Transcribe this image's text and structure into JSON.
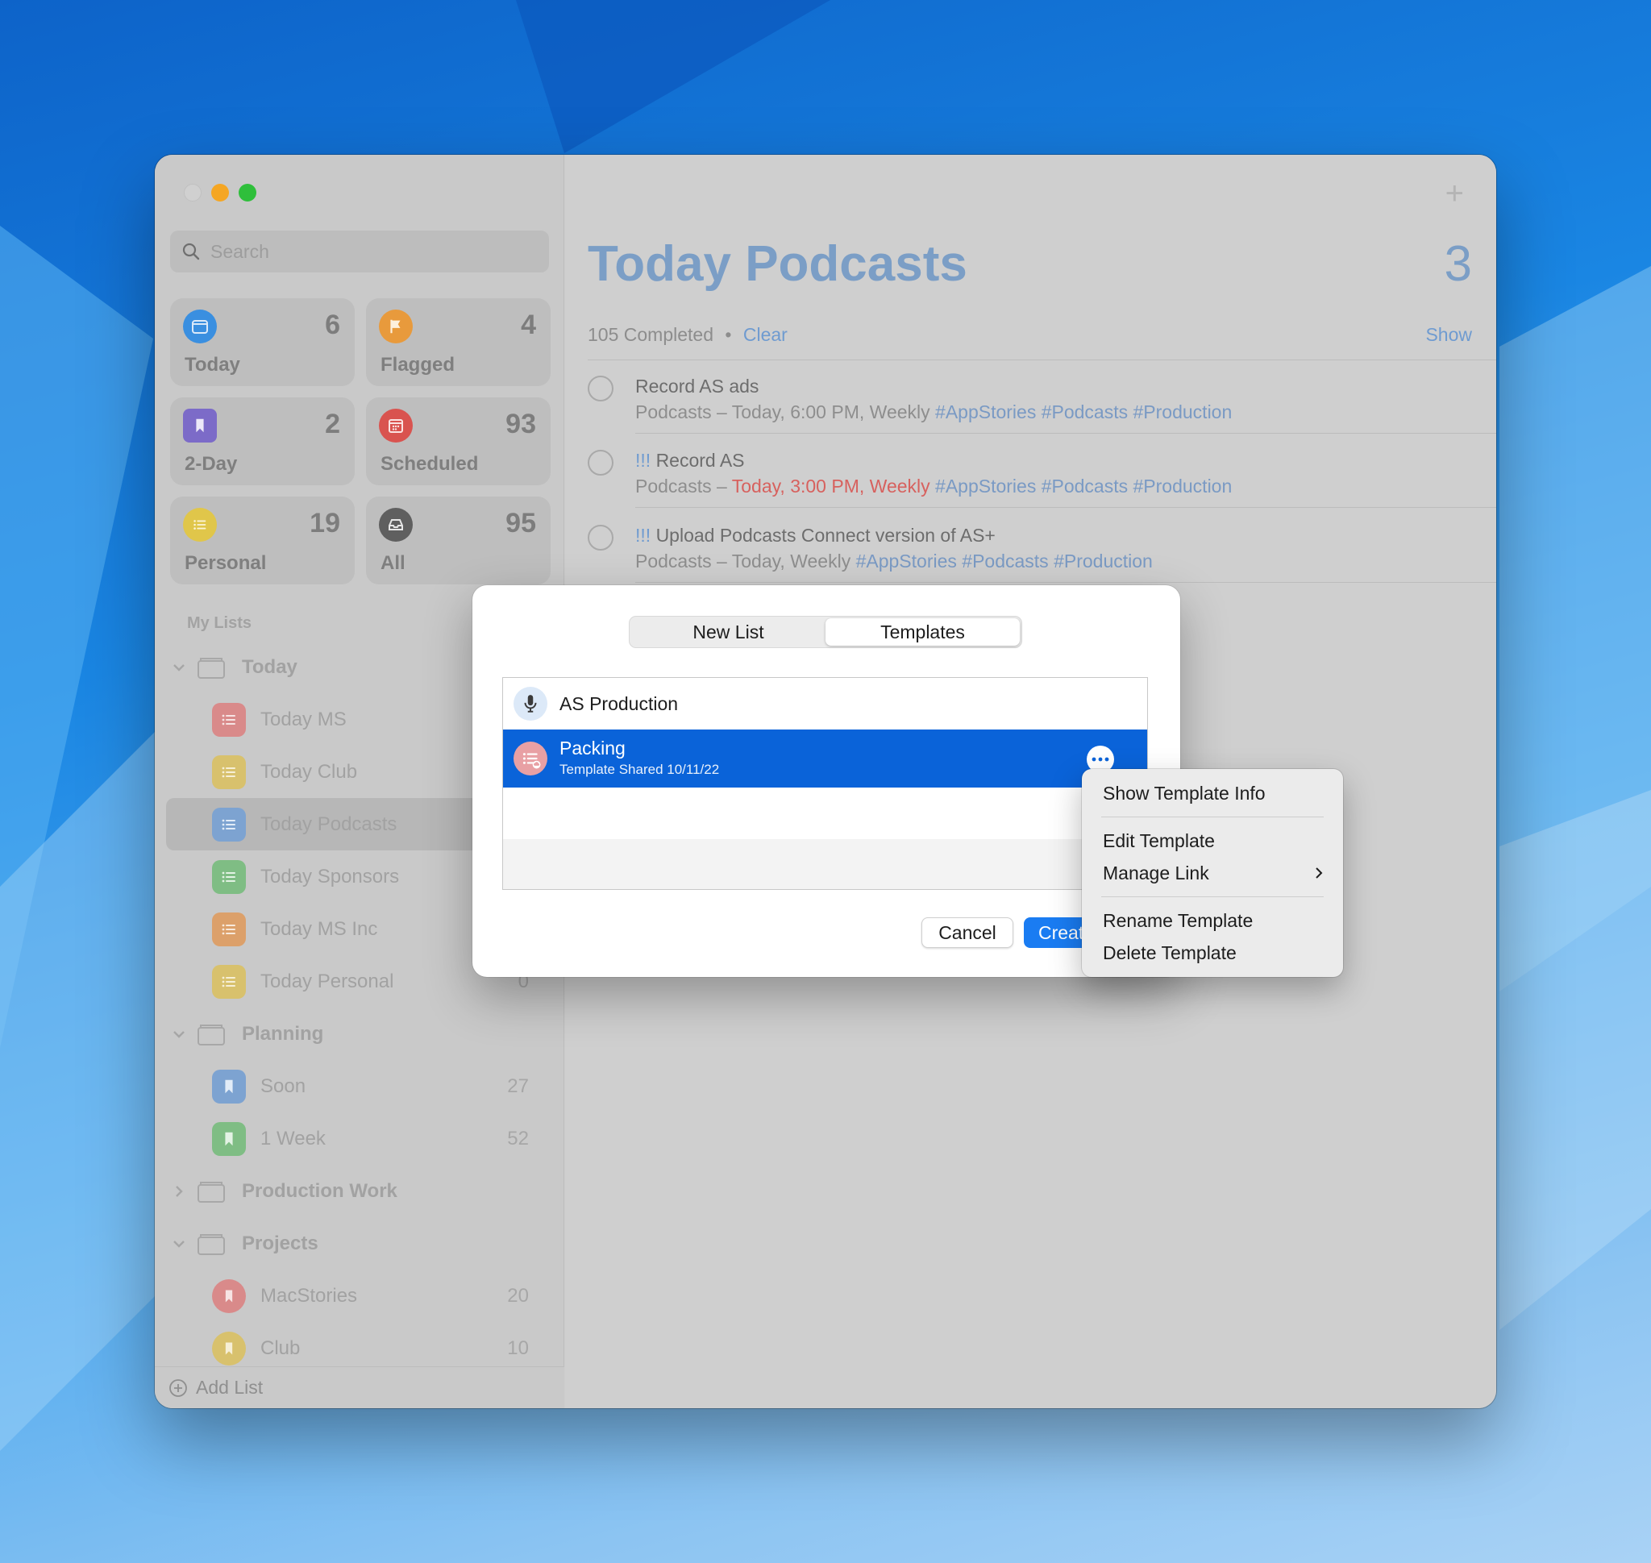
{
  "search": {
    "placeholder": "Search"
  },
  "smart_lists": [
    {
      "label": "Today",
      "count": "6",
      "icon": "calendar-icon",
      "color": "#3a8fe0"
    },
    {
      "label": "Flagged",
      "count": "4",
      "icon": "flag-icon",
      "color": "#e89a3c"
    },
    {
      "label": "2-Day",
      "count": "2",
      "icon": "bookmark-icon",
      "color": "#7c6bc8"
    },
    {
      "label": "Scheduled",
      "count": "93",
      "icon": "calendar-grid-icon",
      "color": "#d9534f"
    },
    {
      "label": "Personal",
      "count": "19",
      "icon": "list-icon",
      "color": "#e0c64a"
    },
    {
      "label": "All",
      "count": "95",
      "icon": "tray-icon",
      "color": "#5f5f5f"
    }
  ],
  "my_lists_heading": "My Lists",
  "groups": {
    "today": "Today",
    "planning": "Planning",
    "production": "Production Work",
    "projects": "Projects"
  },
  "lists": {
    "today_ms": {
      "name": "Today MS"
    },
    "today_club": {
      "name": "Today Club"
    },
    "today_podcasts": {
      "name": "Today Podcasts"
    },
    "today_sponsors": {
      "name": "Today Sponsors"
    },
    "today_ms_inc": {
      "name": "Today MS Inc"
    },
    "today_personal": {
      "name": "Today Personal",
      "count": "0"
    },
    "soon": {
      "name": "Soon",
      "count": "27"
    },
    "one_week": {
      "name": "1 Week",
      "count": "52"
    },
    "macstories": {
      "name": "MacStories",
      "count": "20"
    },
    "club": {
      "name": "Club",
      "count": "10"
    }
  },
  "add_list": "Add List",
  "main": {
    "title": "Today Podcasts",
    "count": "3",
    "completed": "105 Completed",
    "dot": "•",
    "clear": "Clear",
    "show": "Show",
    "plus": "+"
  },
  "tasks": [
    {
      "priority": "",
      "name": "Record AS ads",
      "sub_plain": "Podcasts – Today, 6:00 PM, Weekly",
      "sub_red": "",
      "tags": "#AppStories #Podcasts #Production"
    },
    {
      "priority": "!!!",
      "name": "Record AS",
      "sub_plain": "Podcasts – ",
      "sub_red": "Today, 3:00 PM, Weekly",
      "tags": "#AppStories #Podcasts #Production"
    },
    {
      "priority": "!!!",
      "name": "Upload Podcasts Connect version of AS+",
      "sub_plain": "Podcasts – Today, Weekly",
      "sub_red": "",
      "tags": "#AppStories #Podcasts #Production"
    }
  ],
  "dialog": {
    "tabs": [
      "New List",
      "Templates"
    ],
    "templates": [
      {
        "name": "AS Production"
      },
      {
        "name": "Packing",
        "subtitle": "Template Shared 10/11/22"
      }
    ],
    "cancel": "Cancel",
    "create": "Create"
  },
  "context_menu": {
    "show_info": "Show Template Info",
    "edit": "Edit Template",
    "manage_link": "Manage Link",
    "rename": "Rename Template",
    "delete": "Delete Template"
  }
}
